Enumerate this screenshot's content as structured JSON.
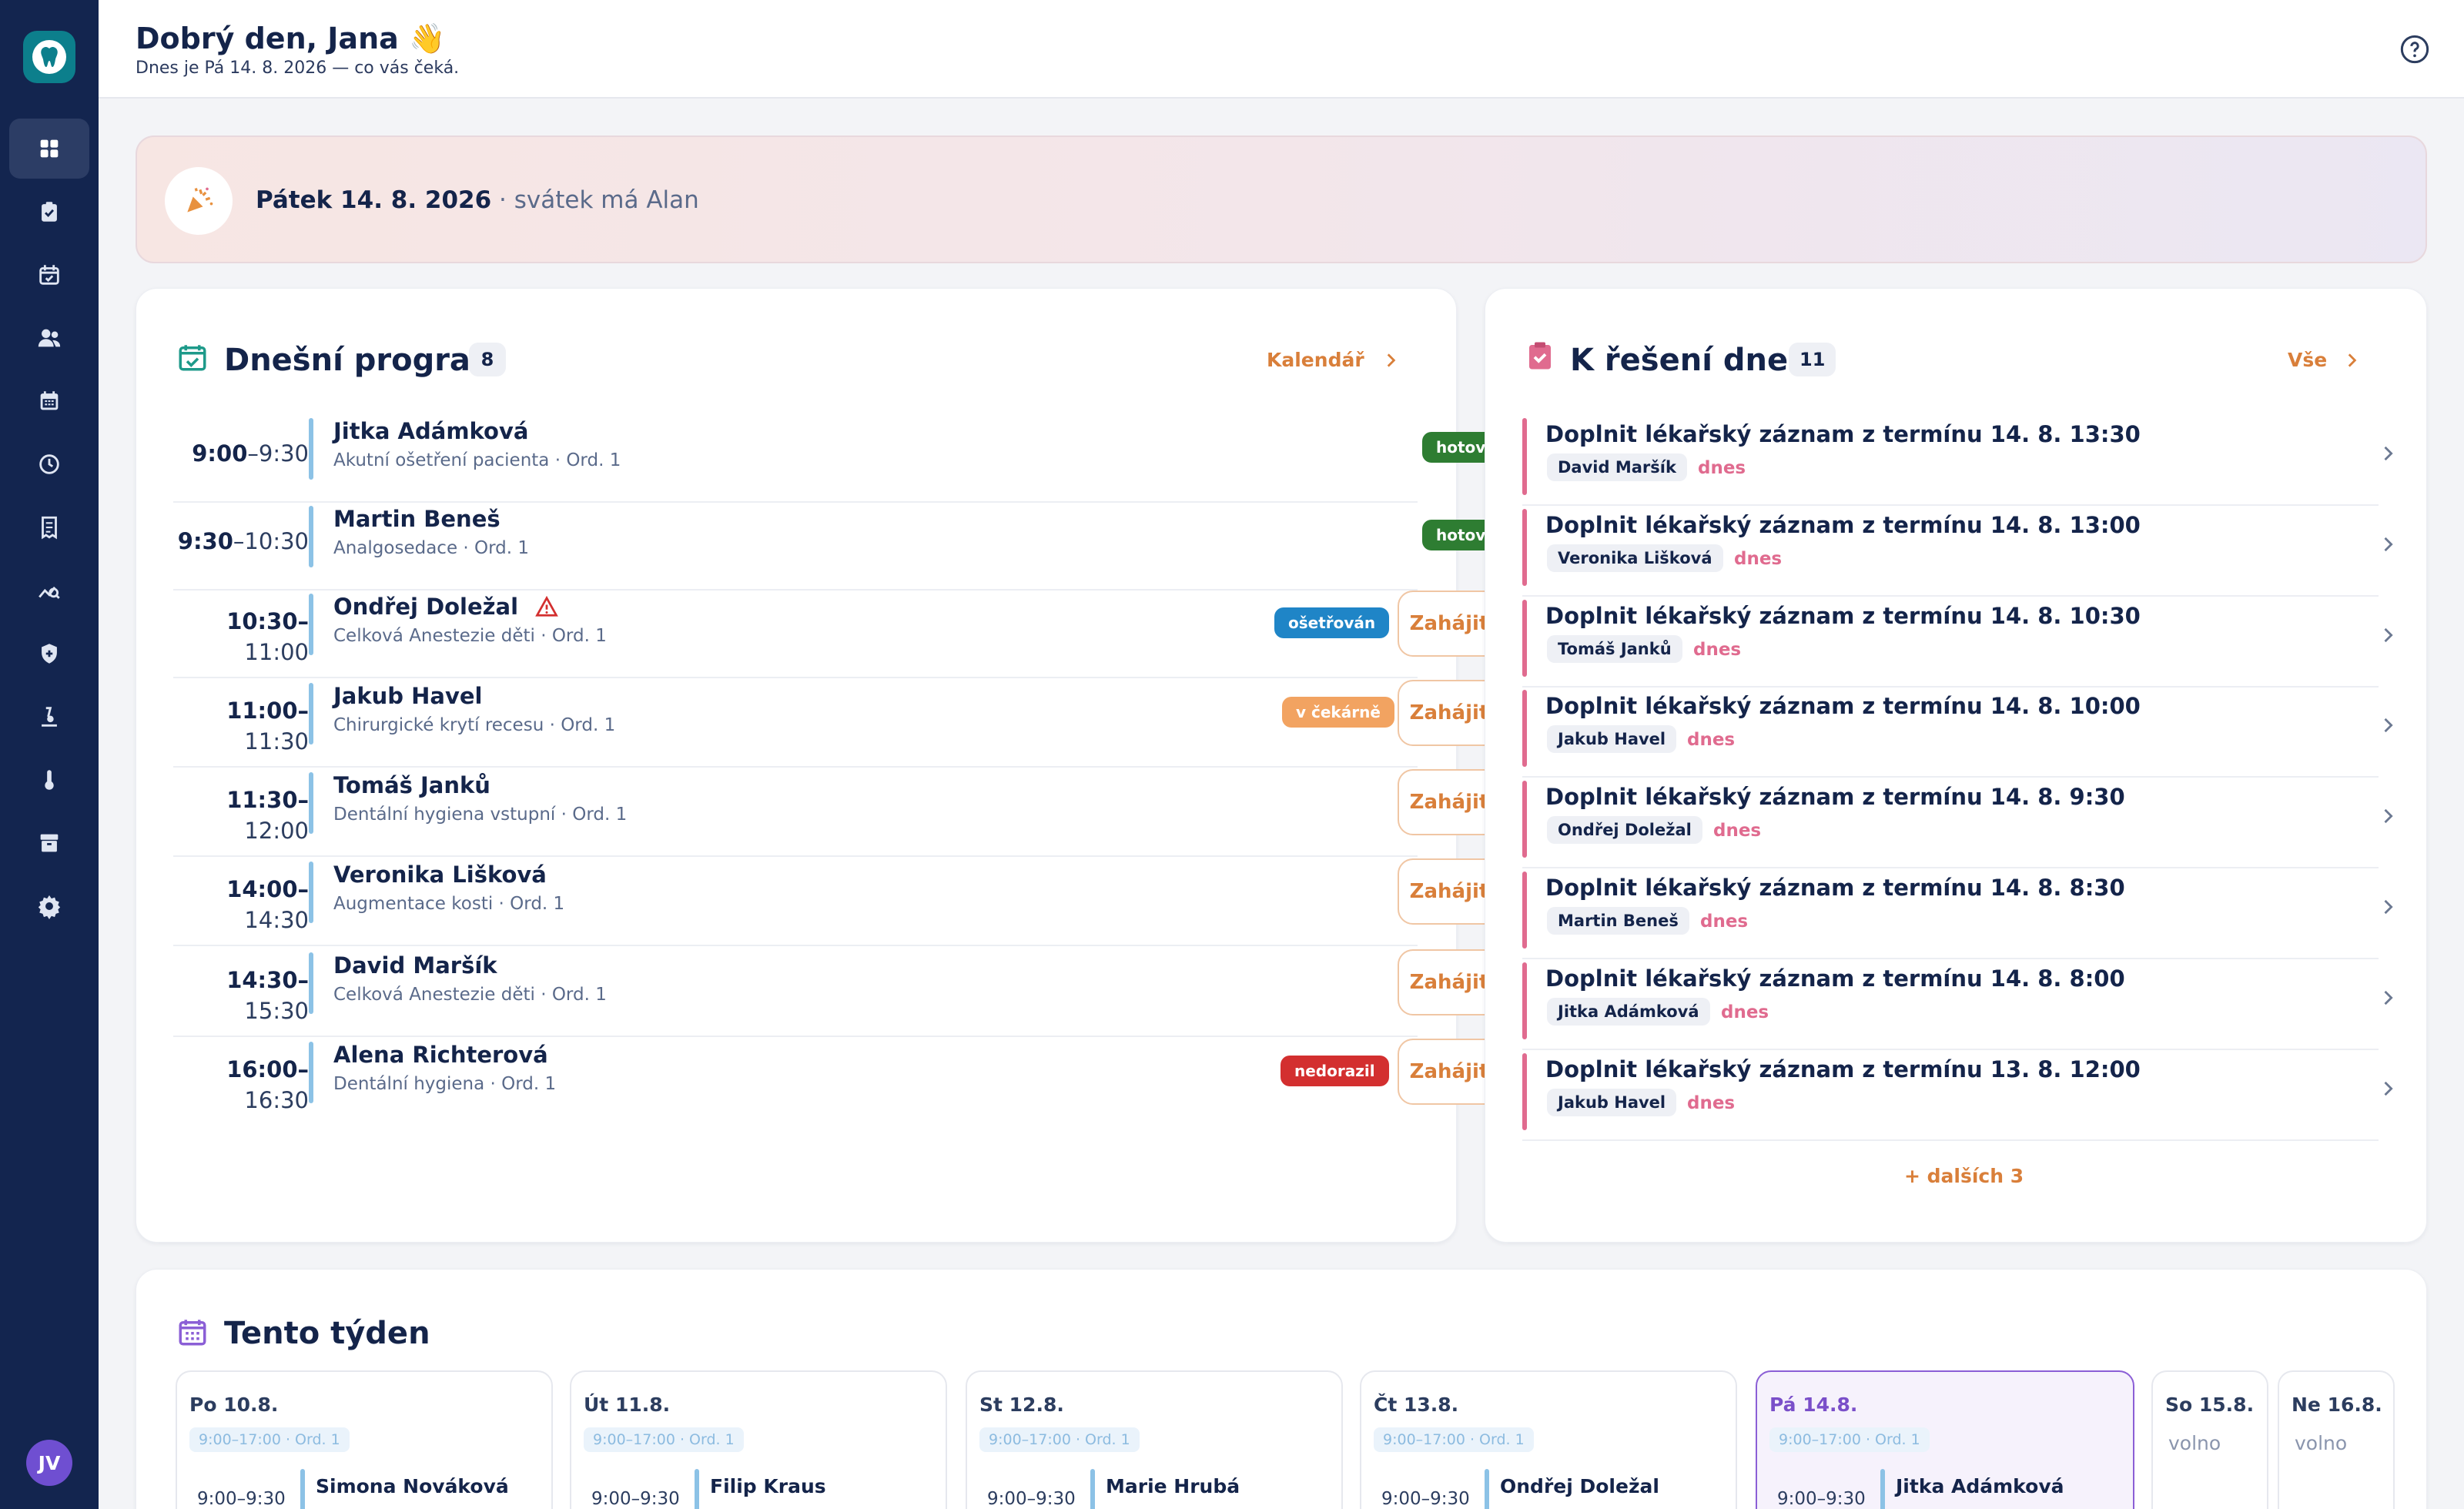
{
  "header": {
    "greeting": "Dobrý den, Jana 👋",
    "subtitle": "Dnes je Pá 14. 8. 2026 — co vás čeká."
  },
  "sidebar": {
    "user_initials": "JV",
    "items": [
      {
        "icon": "dashboard-icon",
        "active": true
      },
      {
        "icon": "tasks-icon"
      },
      {
        "icon": "calendar-check-icon"
      },
      {
        "icon": "patients-icon"
      },
      {
        "icon": "calendar-icon"
      },
      {
        "icon": "clock-icon"
      },
      {
        "icon": "receipt-icon"
      },
      {
        "icon": "analytics-icon"
      },
      {
        "icon": "shield-icon"
      },
      {
        "icon": "lab-icon"
      },
      {
        "icon": "thermometer-icon"
      },
      {
        "icon": "archive-icon"
      },
      {
        "icon": "settings-icon"
      }
    ]
  },
  "banner": {
    "date": "Pátek 14. 8. 2026",
    "nameday": " · svátek má Alan"
  },
  "program": {
    "title": "Dnešní program",
    "count": "8",
    "calendar_link": "Kalendář",
    "start_label": "Zahájit",
    "rows": [
      {
        "start": "9:00",
        "end": "–9:30",
        "name": "Jitka Adámková",
        "desc": "Akutní ošetření pacienta · Ord. 1",
        "status": "hotovo"
      },
      {
        "start": "9:30",
        "end": "–10:30",
        "name": "Martin Beneš",
        "desc": "Analgosedace · Ord. 1",
        "status": "hotovo"
      },
      {
        "start": "10:30–",
        "end": "11:00",
        "name": "Ondřej Doležal",
        "desc": "Celková Anestezie děti · Ord. 1",
        "status": "ošetřován",
        "warning": true
      },
      {
        "start": "11:00–",
        "end": "11:30",
        "name": "Jakub Havel",
        "desc": "Chirurgické krytí recesu · Ord. 1",
        "status": "v čekárně"
      },
      {
        "start": "11:30–",
        "end": "12:00",
        "name": "Tomáš Janků",
        "desc": "Dentální hygiena vstupní · Ord. 1",
        "status": ""
      },
      {
        "start": "14:00–",
        "end": "14:30",
        "name": "Veronika Lišková",
        "desc": "Augmentace kosti · Ord. 1",
        "status": ""
      },
      {
        "start": "14:30–",
        "end": "15:30",
        "name": "David Maršík",
        "desc": "Celková Anestezie děti · Ord. 1",
        "status": ""
      },
      {
        "start": "16:00–",
        "end": "16:30",
        "name": "Alena Richterová",
        "desc": "Dentální hygiena · Ord. 1",
        "status": "nedorazil"
      }
    ]
  },
  "tasks": {
    "title": "K řešení dnes",
    "count": "11",
    "all_link": "Vše",
    "more": "+ dalších 3",
    "items": [
      {
        "title": "Doplnit lékařský záznam z termínu 14. 8. 13:30",
        "patient": "David Maršík",
        "when": "dnes"
      },
      {
        "title": "Doplnit lékařský záznam z termínu 14. 8. 13:00",
        "patient": "Veronika Lišková",
        "when": "dnes"
      },
      {
        "title": "Doplnit lékařský záznam z termínu 14. 8. 10:30",
        "patient": "Tomáš Janků",
        "when": "dnes"
      },
      {
        "title": "Doplnit lékařský záznam z termínu 14. 8. 10:00",
        "patient": "Jakub Havel",
        "when": "dnes"
      },
      {
        "title": "Doplnit lékařský záznam z termínu 14. 8. 9:30",
        "patient": "Ondřej Doležal",
        "when": "dnes"
      },
      {
        "title": "Doplnit lékařský záznam z termínu 14. 8. 8:30",
        "patient": "Martin Beneš",
        "when": "dnes"
      },
      {
        "title": "Doplnit lékařský záznam z termínu 14. 8. 8:00",
        "patient": "Jitka Adámková",
        "when": "dnes"
      },
      {
        "title": "Doplnit lékařský záznam z termínu 13. 8. 12:00",
        "patient": "Jakub Havel",
        "when": "dnes"
      }
    ]
  },
  "week": {
    "title": "Tento týden",
    "days": [
      {
        "label": "Po 10.8.",
        "hours": "9:00–17:00 · Ord. 1",
        "first_time": "9:00–9:30",
        "first_name": "Simona Nováková"
      },
      {
        "label": "Út 11.8.",
        "hours": "9:00–17:00 · Ord. 1",
        "first_time": "9:00–9:30",
        "first_name": "Filip Kraus"
      },
      {
        "label": "St 12.8.",
        "hours": "9:00–17:00 · Ord. 1",
        "first_time": "9:00–9:30",
        "first_name": "Marie Hrubá"
      },
      {
        "label": "Čt 13.8.",
        "hours": "9:00–17:00 · Ord. 1",
        "first_time": "9:00–9:30",
        "first_name": "Ondřej Doležal"
      },
      {
        "label": "Pá 14.8.",
        "hours": "9:00–17:00 · Ord. 1",
        "first_time": "9:00–9:30",
        "first_name": "Jitka Adámková",
        "active": true
      },
      {
        "label": "So 15.8.",
        "free": "volno"
      },
      {
        "label": "Ne 16.8.",
        "free": "volno"
      }
    ]
  },
  "colors": {
    "sidebar": "#13254f",
    "accent": "#d97f3a",
    "done": "#2e7d32",
    "in_treatment": "#1f85c7",
    "waiting": "#f2a361",
    "no_show": "#d32f2f",
    "task_accent": "#e06b8f",
    "week_accent": "#7a4fc9"
  }
}
